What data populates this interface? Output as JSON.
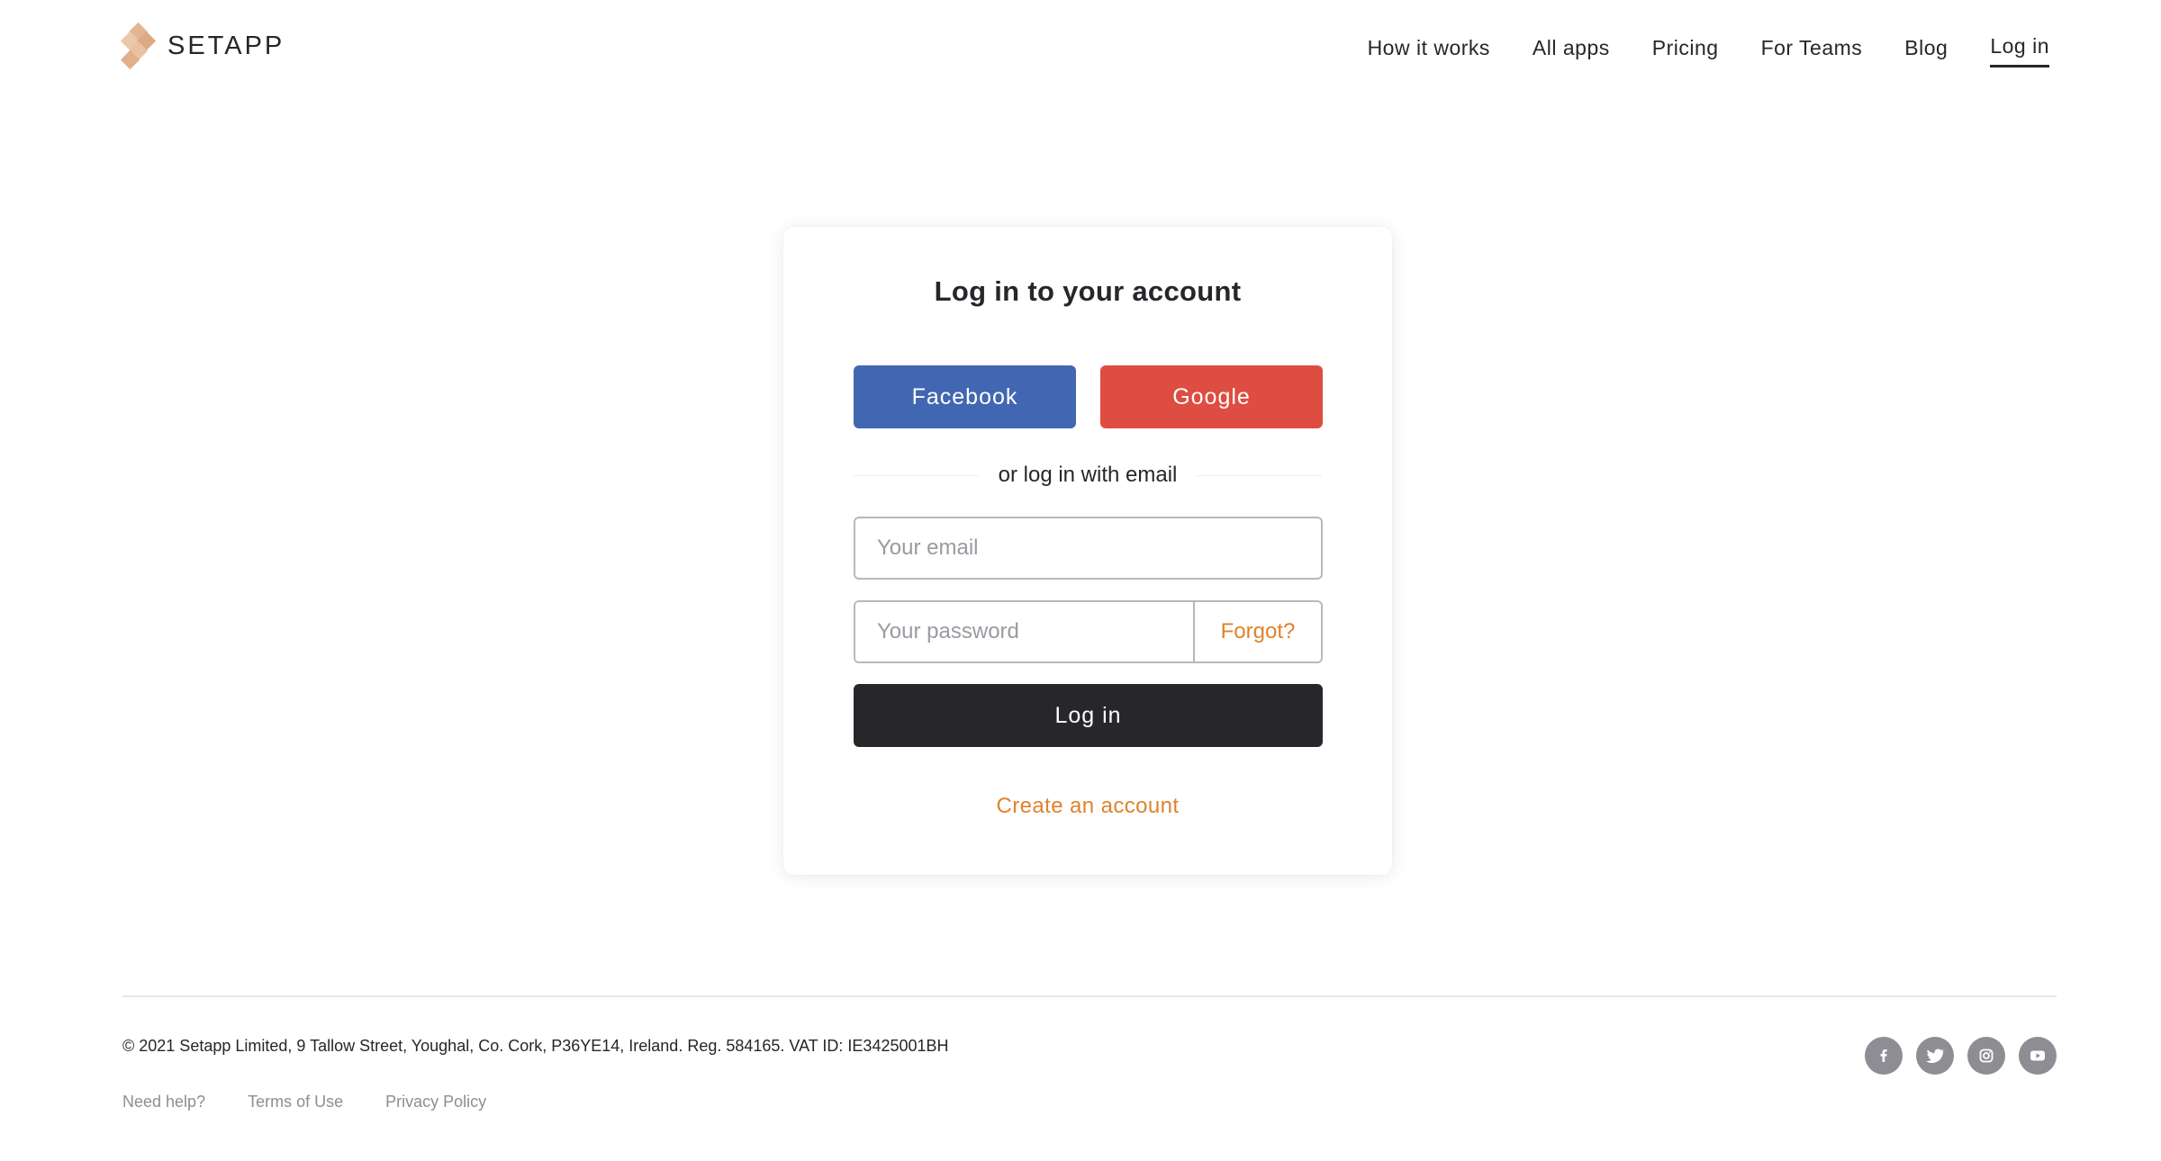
{
  "header": {
    "brand": "SETAPP",
    "nav": [
      {
        "label": "How it works"
      },
      {
        "label": "All apps"
      },
      {
        "label": "Pricing"
      },
      {
        "label": "For Teams"
      },
      {
        "label": "Blog"
      },
      {
        "label": "Log in",
        "active": true
      }
    ]
  },
  "login": {
    "title": "Log in to your account",
    "facebook_label": "Facebook",
    "google_label": "Google",
    "divider_text": "or log in with email",
    "email_placeholder": "Your email",
    "email_value": "",
    "password_placeholder": "Your password",
    "password_value": "",
    "forgot_label": "Forgot?",
    "submit_label": "Log in",
    "create_account_label": "Create an account"
  },
  "footer": {
    "copyright": "© 2021 Setapp Limited, 9 Tallow Street, Youghal, Co. Cork, P36YE14, Ireland. Reg. 584165. VAT ID: IE3425001BH",
    "links": [
      {
        "label": "Need help?"
      },
      {
        "label": "Terms of Use"
      },
      {
        "label": "Privacy Policy"
      }
    ],
    "socials": [
      "facebook-icon",
      "twitter-icon",
      "instagram-icon",
      "youtube-icon"
    ]
  },
  "colors": {
    "facebook": "#4267b2",
    "google": "#de4d41",
    "accent": "#e0822c",
    "dark": "#26262b",
    "logo": "#e3b592"
  }
}
